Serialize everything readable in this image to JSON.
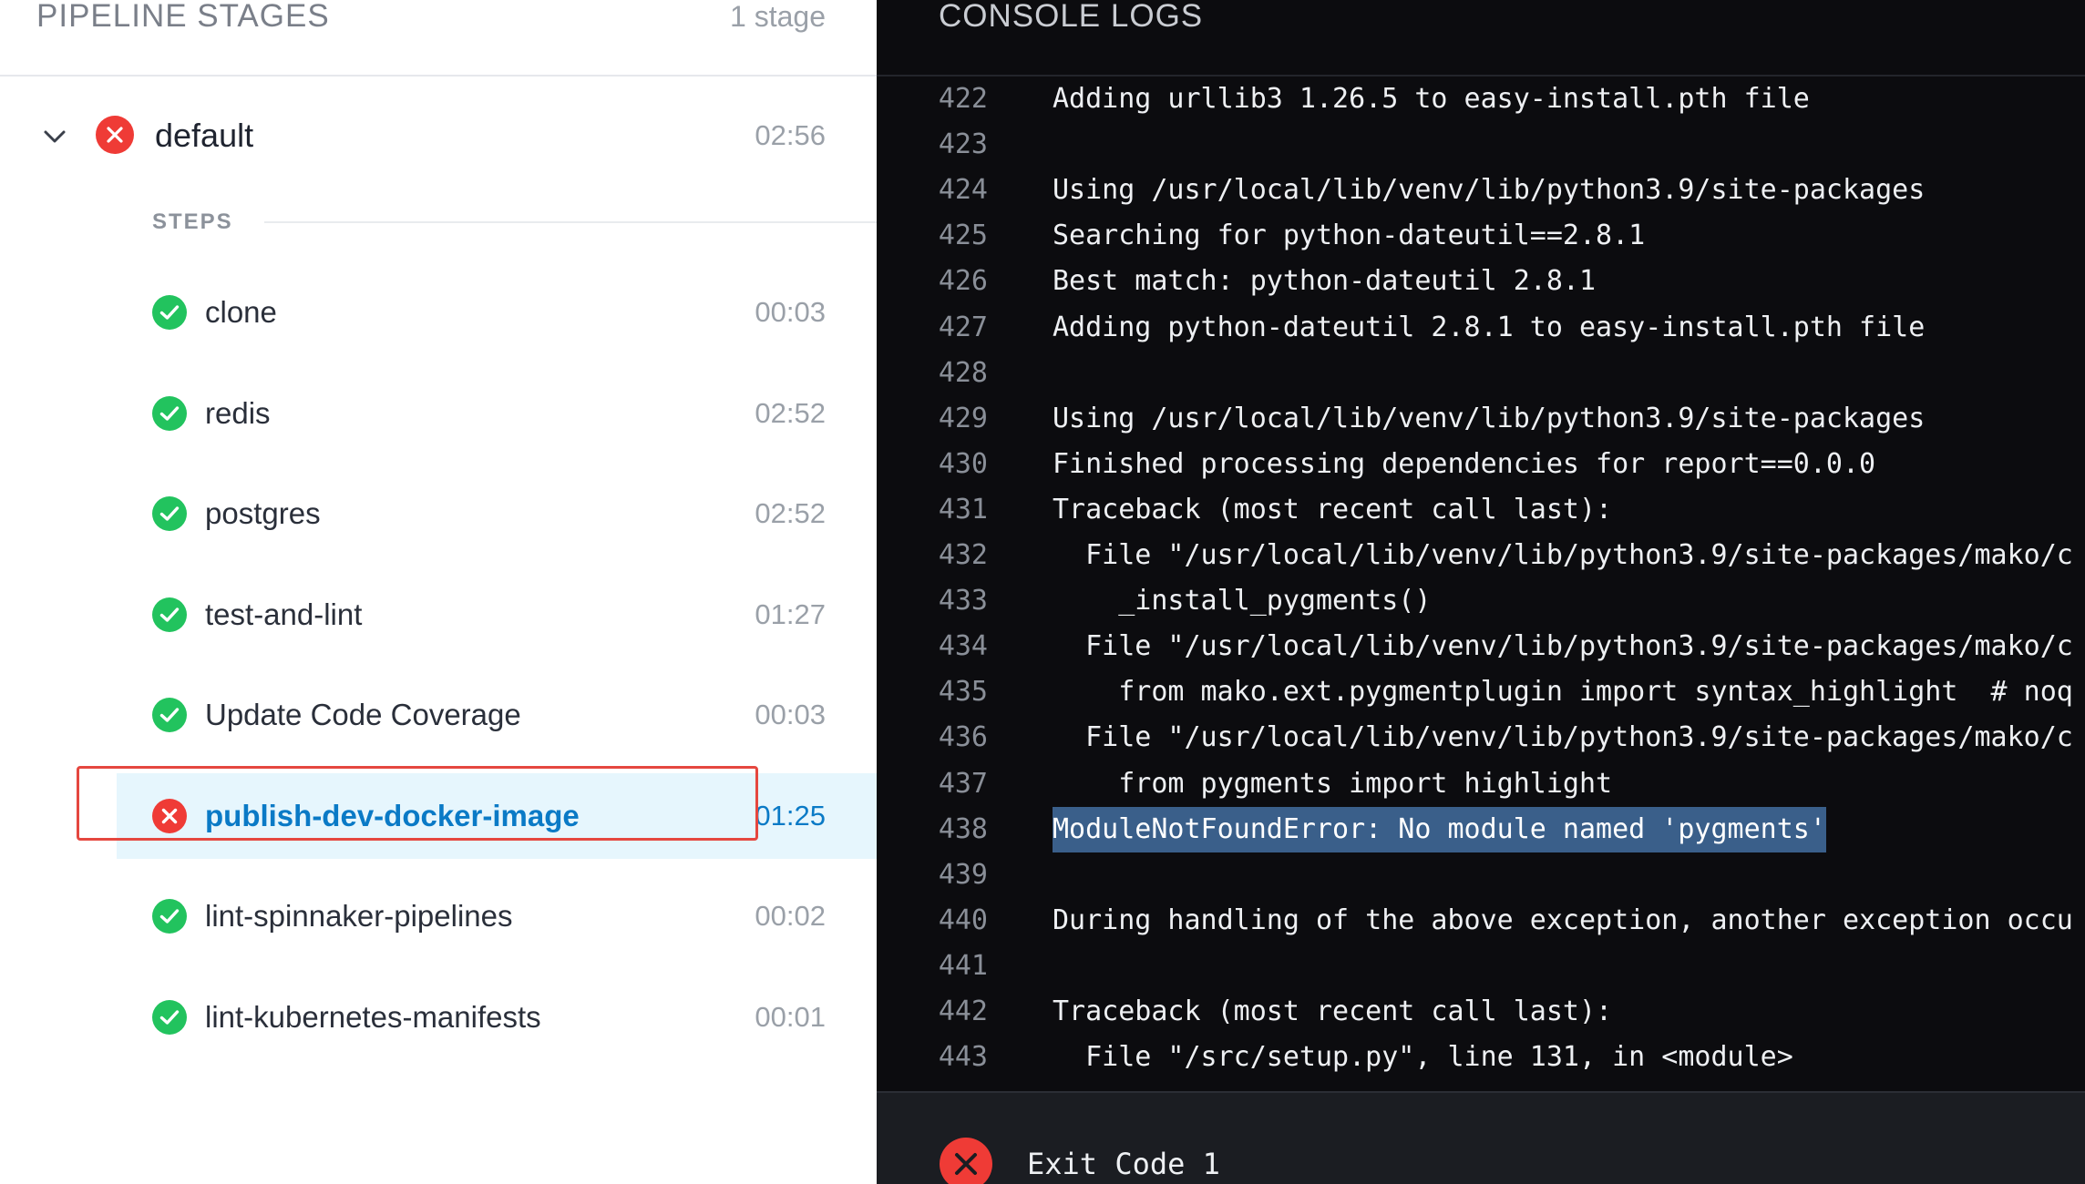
{
  "pipeline": {
    "title": "PIPELINE STAGES",
    "count": "1 stage",
    "stage": {
      "name": "default",
      "time": "02:56",
      "status": "failed"
    },
    "steps_label": "STEPS",
    "steps": [
      {
        "name": "clone",
        "time": "00:03",
        "status": "success"
      },
      {
        "name": "redis",
        "time": "02:52",
        "status": "success"
      },
      {
        "name": "postgres",
        "time": "02:52",
        "status": "success"
      },
      {
        "name": "test-and-lint",
        "time": "01:27",
        "status": "success"
      },
      {
        "name": "Update Code Coverage",
        "time": "00:03",
        "status": "success"
      },
      {
        "name": "publish-dev-docker-image",
        "time": "01:25",
        "status": "failed"
      },
      {
        "name": "lint-spinnaker-pipelines",
        "time": "00:02",
        "status": "success"
      },
      {
        "name": "lint-kubernetes-manifests",
        "time": "00:01",
        "status": "success"
      }
    ]
  },
  "console": {
    "title": "CONSOLE LOGS",
    "lines": [
      {
        "n": "422",
        "t": "Adding urllib3 1.26.5 to easy-install.pth file"
      },
      {
        "n": "423",
        "t": ""
      },
      {
        "n": "424",
        "t": "Using /usr/local/lib/venv/lib/python3.9/site-packages"
      },
      {
        "n": "425",
        "t": "Searching for python-dateutil==2.8.1"
      },
      {
        "n": "426",
        "t": "Best match: python-dateutil 2.8.1"
      },
      {
        "n": "427",
        "t": "Adding python-dateutil 2.8.1 to easy-install.pth file"
      },
      {
        "n": "428",
        "t": ""
      },
      {
        "n": "429",
        "t": "Using /usr/local/lib/venv/lib/python3.9/site-packages"
      },
      {
        "n": "430",
        "t": "Finished processing dependencies for report==0.0.0"
      },
      {
        "n": "431",
        "t": "Traceback (most recent call last):"
      },
      {
        "n": "432",
        "t": "  File \"/usr/local/lib/venv/lib/python3.9/site-packages/mako/c"
      },
      {
        "n": "433",
        "t": "    _install_pygments()"
      },
      {
        "n": "434",
        "t": "  File \"/usr/local/lib/venv/lib/python3.9/site-packages/mako/c"
      },
      {
        "n": "435",
        "t": "    from mako.ext.pygmentplugin import syntax_highlight  # noq"
      },
      {
        "n": "436",
        "t": "  File \"/usr/local/lib/venv/lib/python3.9/site-packages/mako/c"
      },
      {
        "n": "437",
        "t": "    from pygments import highlight"
      },
      {
        "n": "438",
        "t": "ModuleNotFoundError: No module named 'pygments'",
        "error": true
      },
      {
        "n": "439",
        "t": ""
      },
      {
        "n": "440",
        "t": "During handling of the above exception, another exception occu"
      },
      {
        "n": "441",
        "t": ""
      },
      {
        "n": "442",
        "t": "Traceback (most recent call last):"
      },
      {
        "n": "443",
        "t": "  File \"/src/setup.py\", line 131, in <module>"
      }
    ],
    "exit_text": "Exit Code 1"
  },
  "colors": {
    "success": "#22c35e",
    "failed": "#ef3b36",
    "active_text": "#0a7ac6",
    "active_bg": "#e6f6fd",
    "error_highlight": "#3a5f8a"
  }
}
